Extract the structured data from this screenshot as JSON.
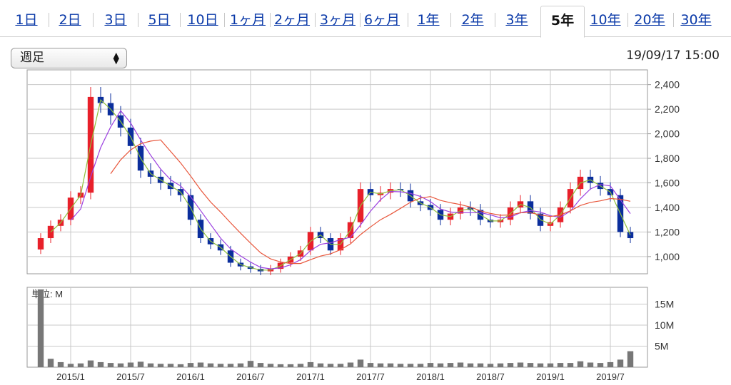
{
  "tabs": [
    {
      "label": "1日",
      "active": false
    },
    {
      "label": "2日",
      "active": false
    },
    {
      "label": "3日",
      "active": false
    },
    {
      "label": "5日",
      "active": false
    },
    {
      "label": "10日",
      "active": false
    },
    {
      "label": "1ヶ月",
      "active": false
    },
    {
      "label": "2ヶ月",
      "active": false
    },
    {
      "label": "3ヶ月",
      "active": false
    },
    {
      "label": "6ヶ月",
      "active": false
    },
    {
      "label": "1年",
      "active": false
    },
    {
      "label": "2年",
      "active": false
    },
    {
      "label": "3年",
      "active": false
    },
    {
      "label": "5年",
      "active": true
    },
    {
      "label": "10年",
      "active": false
    },
    {
      "label": "20年",
      "active": false
    },
    {
      "label": "30年",
      "active": false
    }
  ],
  "period_select": {
    "value": "週足"
  },
  "timestamp": "19/09/17 15:00",
  "colors": {
    "up": "#e8202a",
    "down": "#0b2e9c",
    "ma_short": "#8fbf3a",
    "ma_mid": "#9b3fe0",
    "ma_long": "#e8553a",
    "volume": "#777777",
    "grid": "#c8c8c8",
    "tab_link": "#0a39a8"
  },
  "chart_data": [
    {
      "type": "candlestick",
      "x_ticks": [
        "2015/1",
        "2015/7",
        "2016/1",
        "2016/7",
        "2017/1",
        "2017/7",
        "2018/1",
        "2018/7",
        "2019/1",
        "2019/7"
      ],
      "y_ticks": [
        1000,
        1200,
        1400,
        1600,
        1800,
        2000,
        2200,
        2400
      ],
      "y_tick_labels": [
        "1,000",
        "1,200",
        "1,400",
        "1,600",
        "1,800",
        "2,000",
        "2,200",
        "2,400"
      ],
      "ylim": [
        860,
        2520
      ],
      "xlim": [
        "2014/10",
        "2019/10"
      ],
      "series": [
        {
          "x": [
            "2014/10",
            "2014/11",
            "2014/12",
            "2015/1",
            "2015/2",
            "2015/3",
            "2015/4",
            "2015/5",
            "2015/6",
            "2015/7",
            "2015/8",
            "2015/9",
            "2015/10",
            "2015/11",
            "2015/12",
            "2016/1",
            "2016/2",
            "2016/3",
            "2016/4",
            "2016/5",
            "2016/6",
            "2016/7",
            "2016/8",
            "2016/9",
            "2016/10",
            "2016/11",
            "2016/12",
            "2017/1",
            "2017/2",
            "2017/3",
            "2017/4",
            "2017/5",
            "2017/6",
            "2017/7",
            "2017/8",
            "2017/9",
            "2017/10",
            "2017/11",
            "2017/12",
            "2018/1",
            "2018/2",
            "2018/3",
            "2018/4",
            "2018/5",
            "2018/6",
            "2018/7",
            "2018/8",
            "2018/9",
            "2018/10",
            "2018/11",
            "2018/12",
            "2019/1",
            "2019/2",
            "2019/3",
            "2019/4",
            "2019/5",
            "2019/6",
            "2019/7",
            "2019/8",
            "2019/9"
          ],
          "close": [
            1150,
            1250,
            1300,
            1480,
            1520,
            2300,
            2250,
            2150,
            2050,
            1900,
            1700,
            1650,
            1600,
            1550,
            1500,
            1300,
            1150,
            1100,
            1050,
            950,
            920,
            900,
            880,
            900,
            950,
            1000,
            1050,
            1200,
            1150,
            1050,
            1150,
            1280,
            1550,
            1500,
            1520,
            1550,
            1540,
            1450,
            1420,
            1380,
            1300,
            1350,
            1400,
            1380,
            1300,
            1280,
            1300,
            1400,
            1450,
            1350,
            1250,
            1280,
            1400,
            1550,
            1650,
            1600,
            1550,
            1500,
            1200,
            1150
          ]
        }
      ],
      "ma_lines": [
        {
          "name": "",
          "color": "#8fbf3a"
        },
        {
          "name": "",
          "color": "#9b3fe0"
        },
        {
          "name": "",
          "color": "#e8553a"
        }
      ]
    },
    {
      "type": "bar",
      "unit_label": "単位: M",
      "y_tick_labels": [
        "15M",
        "10M",
        "5M"
      ],
      "y_ticks": [
        15,
        10,
        5
      ],
      "ylim": [
        0,
        19
      ],
      "x": [
        "2014/10",
        "2014/11",
        "2014/12",
        "2015/1",
        "2015/2",
        "2015/3",
        "2015/4",
        "2015/5",
        "2015/6",
        "2015/7",
        "2015/8",
        "2015/9",
        "2015/10",
        "2015/11",
        "2015/12",
        "2016/1",
        "2016/2",
        "2016/3",
        "2016/4",
        "2016/5",
        "2016/6",
        "2016/7",
        "2016/8",
        "2016/9",
        "2016/10",
        "2016/11",
        "2016/12",
        "2017/1",
        "2017/2",
        "2017/3",
        "2017/4",
        "2017/5",
        "2017/6",
        "2017/7",
        "2017/8",
        "2017/9",
        "2017/10",
        "2017/11",
        "2017/12",
        "2018/1",
        "2018/2",
        "2018/3",
        "2018/4",
        "2018/5",
        "2018/6",
        "2018/7",
        "2018/8",
        "2018/9",
        "2018/10",
        "2018/11",
        "2018/12",
        "2019/1",
        "2019/2",
        "2019/3",
        "2019/4",
        "2019/5",
        "2019/6",
        "2019/7",
        "2019/8",
        "2019/9"
      ],
      "values": [
        18.5,
        2.0,
        1.2,
        0.8,
        0.9,
        1.6,
        1.2,
        1.0,
        0.9,
        1.1,
        1.3,
        0.9,
        0.8,
        0.8,
        0.7,
        1.0,
        1.1,
        0.9,
        0.8,
        0.8,
        0.9,
        1.5,
        1.0,
        0.8,
        0.7,
        0.7,
        0.8,
        1.2,
        0.9,
        0.8,
        0.8,
        1.1,
        1.8,
        1.0,
        0.9,
        0.9,
        0.8,
        0.8,
        0.8,
        1.0,
        0.9,
        1.0,
        1.1,
        0.9,
        0.9,
        0.8,
        0.9,
        1.0,
        1.1,
        1.0,
        0.9,
        0.9,
        1.0,
        1.0,
        1.4,
        1.1,
        1.0,
        1.2,
        1.8,
        3.8
      ]
    }
  ]
}
